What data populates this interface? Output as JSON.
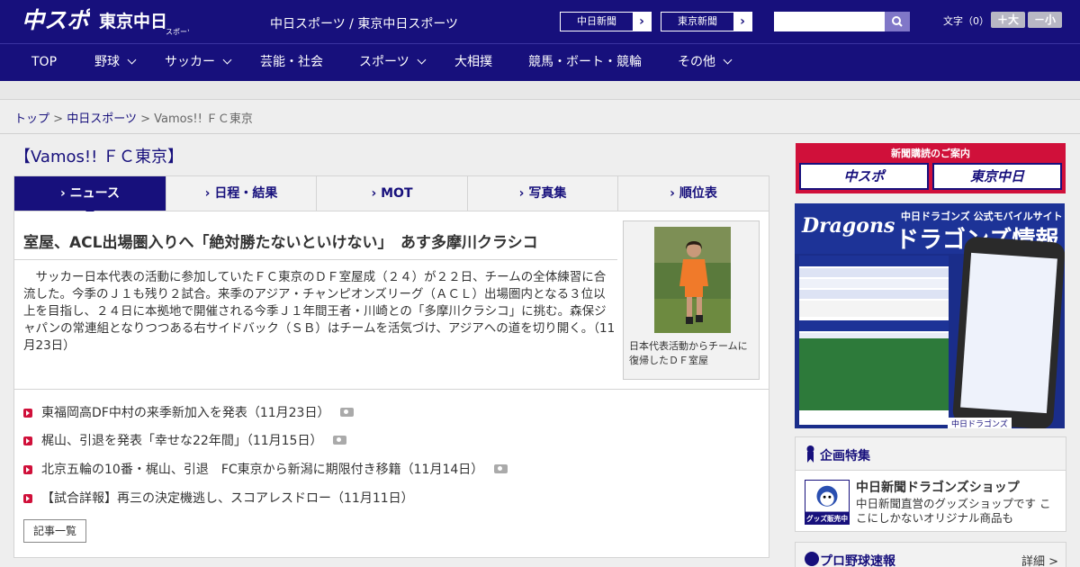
{
  "header": {
    "logo_chuspo": "中スポ",
    "logo_tokyo": "東京中日",
    "logo_tokyo_sub": "スポーツ",
    "site_name": "中日スポーツ / 東京中日スポーツ",
    "links": [
      "中日新聞",
      "東京新聞"
    ],
    "fontsize_label": "文字（0）",
    "font_plus": "＋大",
    "font_minus": "－小",
    "search_placeholder": ""
  },
  "nav": {
    "items": [
      {
        "label": "TOP",
        "dropdown": false
      },
      {
        "label": "野球",
        "dropdown": true
      },
      {
        "label": "サッカー",
        "dropdown": true
      },
      {
        "label": "芸能・社会",
        "dropdown": false
      },
      {
        "label": "スポーツ",
        "dropdown": true
      },
      {
        "label": "大相撲",
        "dropdown": false
      },
      {
        "label": "競馬・ボート・競輪",
        "dropdown": false
      },
      {
        "label": "その他",
        "dropdown": true
      }
    ]
  },
  "breadcrumb": {
    "home": "トップ",
    "section": "中日スポーツ",
    "current": "Vamos!! ＦＣ東京",
    "sep": ">"
  },
  "page": {
    "title": "【Vamos!! ＦＣ東京】"
  },
  "tabs": [
    {
      "label": "ニュース",
      "active": true
    },
    {
      "label": "日程・結果",
      "active": false
    },
    {
      "label": "MOT",
      "active": false
    },
    {
      "label": "写真集",
      "active": false
    },
    {
      "label": "順位表",
      "active": false
    }
  ],
  "article": {
    "headline": "室屋、ACL出場圏入りへ「絶対勝たないといけない」　あす多摩川クラシコ",
    "lead": "　サッカー日本代表の活動に参加していたＦＣ東京のＤＦ室屋成（２４）が２２日、チームの全体練習に合流した。今季のＪ１も残り２試合。来季のアジア・チャンピオンズリーグ（ＡＣＬ）出場圏内となる３位以上を目指し、２４日に本拠地で開催される今季Ｊ１年間王者・川崎との「多摩川クラシコ」に挑む。森保ジャパンの常連組となりつつある右サイドバック（ＳＢ）はチームを活気づけ、アジアへの道を切り開く。（11月23日）",
    "photo_caption": "日本代表活動からチームに復帰したＤＦ室屋"
  },
  "news_list": [
    {
      "text": "東福岡高DF中村の来季新加入を発表（11月23日）",
      "photo": true
    },
    {
      "text": "梶山、引退を発表「幸せな22年間」（11月15日）",
      "photo": true
    },
    {
      "text": "北京五輪の10番・梶山、引退　FC東京から新潟に期限付き移籍（11月14日）",
      "photo": true
    },
    {
      "text": "【試合詳報】再三の決定機逃し、スコアレスドロー（11月11日）",
      "photo": false
    }
  ],
  "more_button": "記事一覧",
  "sidebar": {
    "subscribe_title": "新聞購読のご案内",
    "subscribe_chuspo": "中スポ",
    "subscribe_tokyo": "東京中日",
    "dragons_ad_sub": "中日ドラゴンズ 公式モバイルサイト",
    "dragons_ad_main": "ドラゴンズ情報",
    "dragons_ad_logo": "Dragons",
    "dragons_ad_foot": "中日ドラゴンズ",
    "special_title": "企画特集",
    "shop_name": "中日新聞ドラゴンズショップ",
    "shop_desc": "中日新聞直営のグッズショップです ここにしかないオリジナル商品も",
    "shop_badge": "グッズ販売中",
    "baseball_title": "プロ野球速報",
    "baseball_detail": "詳細 >"
  },
  "colors": {
    "brand_navy": "#17107c",
    "accent_red": "#d0103a",
    "search_button": "#8077c8"
  }
}
